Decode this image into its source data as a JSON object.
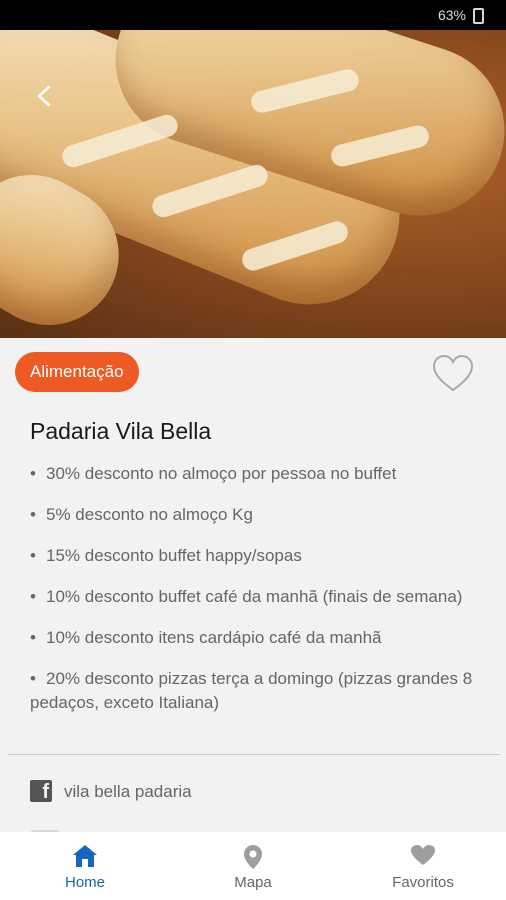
{
  "status_bar": {
    "battery": "63%"
  },
  "offer": {
    "category": "Alimentação",
    "title": "Padaria Vila Bella",
    "benefits": [
      "30% desconto no almoço por pessoa no buffet",
      "5% desconto no almoço Kg",
      "15% desconto buffet happy/sopas",
      "10% desconto buffet café da manhã (finais de semana)",
      "10% desconto itens cardápio café da manhã",
      "20% desconto pizzas terça a domingo (pizzas grandes 8 pedaços, exceto Italiana)"
    ],
    "bullet": "•",
    "facebook": "vila bella padaria"
  },
  "tab_bar": {
    "home": "Home",
    "map": "Mapa",
    "favorites": "Favoritos"
  },
  "colors": {
    "accent": "#ee5a24",
    "active_tab": "#1565c0",
    "inactive_tab": "#9e9e9e"
  },
  "icons": {
    "back": "chevron-left-icon",
    "favorite": "heart-outline-icon",
    "social": "facebook-icon",
    "home": "home-icon",
    "map": "map-pin-icon",
    "favorites": "heart-icon"
  }
}
